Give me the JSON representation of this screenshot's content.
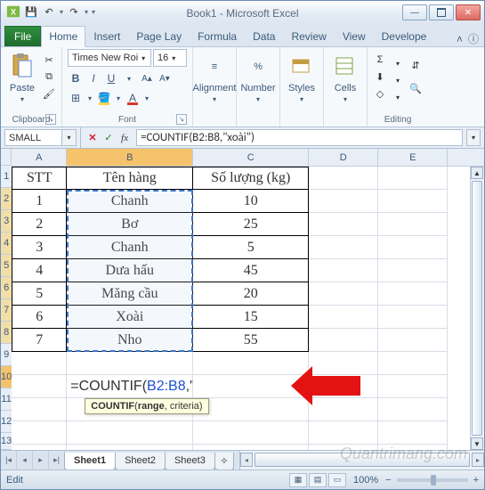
{
  "window": {
    "title": "Book1 - Microsoft Excel"
  },
  "qat": {
    "save": "💾",
    "undo": "↶",
    "redo": "↷"
  },
  "tabs": {
    "file": "File",
    "items": [
      "Home",
      "Insert",
      "Page Lay",
      "Formula",
      "Data",
      "Review",
      "View",
      "Develope"
    ],
    "active": "Home",
    "help_hint": "ⓘ"
  },
  "ribbon": {
    "clipboard": {
      "label": "Clipboard",
      "paste": "Paste",
      "cut": "✂",
      "copy": "⧉",
      "fmt": "🖌"
    },
    "font": {
      "label": "Font",
      "name": "Times New Roi",
      "size": "16",
      "bold": "B",
      "italic": "I",
      "underline": "U",
      "border": "⊞",
      "fill": "▾",
      "color": "A"
    },
    "alignment": {
      "label": "Alignment",
      "btn": "Alignment"
    },
    "number": {
      "label": "Number",
      "btn": "Number"
    },
    "styles": {
      "label": "Styles",
      "btn": "Styles"
    },
    "cells": {
      "label": "Cells",
      "btn": "Cells"
    },
    "editing": {
      "label": "Editing",
      "sum": "Σ",
      "fill": "⬇",
      "clear": "◇",
      "sort": "⇵",
      "find": "🔍"
    }
  },
  "namebox": "SMALL",
  "fx_buttons": {
    "cancel": "✕",
    "enter": "✓",
    "fx": "fx"
  },
  "formula_bar": "=COUNTIF(B2:B8,\"xoài\")",
  "columns": [
    "A",
    "B",
    "C",
    "D",
    "E"
  ],
  "rows_visible": [
    1,
    2,
    3,
    4,
    5,
    6,
    7,
    8,
    9,
    10,
    11,
    12,
    13
  ],
  "table": {
    "headers": {
      "a": "STT",
      "b": "Tên hàng",
      "c": "Số lượng (kg)"
    },
    "rows": [
      {
        "stt": "1",
        "ten": "Chanh",
        "sl": "10"
      },
      {
        "stt": "2",
        "ten": "Bơ",
        "sl": "25"
      },
      {
        "stt": "3",
        "ten": "Chanh",
        "sl": "5"
      },
      {
        "stt": "4",
        "ten": "Dưa hấu",
        "sl": "45"
      },
      {
        "stt": "5",
        "ten": "Măng cầu",
        "sl": "20"
      },
      {
        "stt": "6",
        "ten": "Xoài",
        "sl": "15"
      },
      {
        "stt": "7",
        "ten": "Nho",
        "sl": "55"
      }
    ]
  },
  "editing_cell": {
    "display_prefix": "=COUNTIF(",
    "ref": "B2:B8",
    "suffix": ",\"xoài\")"
  },
  "tooltip": {
    "fn": "COUNTIF",
    "open": "(",
    "arg1": "range",
    "sep": ", criteria)"
  },
  "sheets": {
    "items": [
      "Sheet1",
      "Sheet2",
      "Sheet3"
    ],
    "active": "Sheet1"
  },
  "statusbar": {
    "mode": "Edit",
    "zoom": "100%",
    "minus": "−",
    "plus": "+"
  },
  "watermark": "Quantrimang.com"
}
